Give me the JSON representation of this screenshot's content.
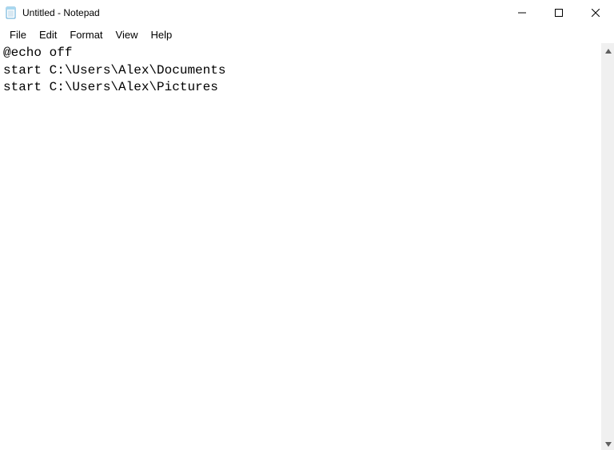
{
  "titlebar": {
    "title": "Untitled - Notepad"
  },
  "menu": {
    "file": "File",
    "edit": "Edit",
    "format": "Format",
    "view": "View",
    "help": "Help"
  },
  "editor": {
    "content": "@echo off\nstart C:\\Users\\Alex\\Documents\nstart C:\\Users\\Alex\\Pictures"
  },
  "icons": {
    "notepad": "notepad-icon",
    "minimize": "minimize-icon",
    "maximize": "maximize-icon",
    "close": "close-icon",
    "scrollUp": "scroll-up-icon",
    "scrollDown": "scroll-down-icon"
  }
}
